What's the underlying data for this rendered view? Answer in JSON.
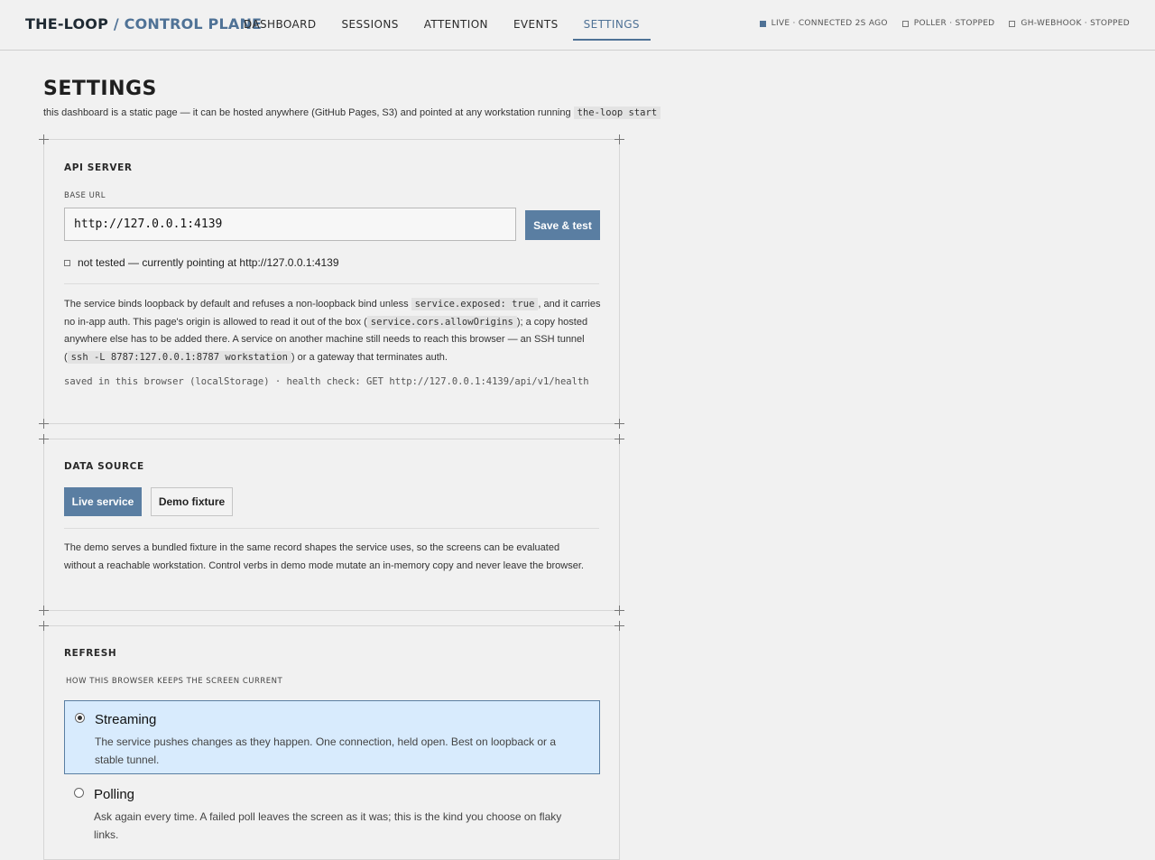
{
  "header": {
    "brand": "THE-LOOP",
    "brand_sub": "/ CONTROL PLANE",
    "nav": [
      "DASHBOARD",
      "SESSIONS",
      "ATTENTION",
      "EVENTS",
      "SETTINGS"
    ],
    "active_nav": "SETTINGS",
    "status": [
      {
        "label": "LIVE · CONNECTED 2S AGO",
        "state": "on"
      },
      {
        "label": "POLLER · STOPPED",
        "state": "off"
      },
      {
        "label": "GH-WEBHOOK · STOPPED",
        "state": "off"
      }
    ]
  },
  "page": {
    "title": "SETTINGS",
    "subtitle": "this dashboard is a static page — it can be hosted anywhere (GitHub Pages, S3) and pointed at any workstation running",
    "subtitle_code": "the-loop start"
  },
  "api_server": {
    "title": "API SERVER",
    "base_url_label": "BASE URL",
    "base_url_value": "http://127.0.0.1:4139",
    "save_button": "Save & test",
    "test_status": "not tested — currently pointing at http://127.0.0.1:4139",
    "para_1": "The service binds loopback by default and refuses a non-loopback bind unless",
    "code_1": "service.exposed: true",
    "para_2": ", and it carries no in-app auth. This page's origin is allowed to read it out of the box (",
    "code_2": "service.cors.allowOrigins",
    "para_3": "); a copy hosted anywhere else has to be added there. A service on another machine still needs to reach this browser — an SSH tunnel (",
    "code_3": "ssh -L 8787:127.0.0.1:8787 workstation",
    "para_4": ") or a gateway that terminates auth.",
    "storage_note": "saved in this browser (localStorage) · health check: GET http://127.0.0.1:4139/api/v1/health"
  },
  "data_source": {
    "title": "DATA SOURCE",
    "live_button": "Live service",
    "demo_button": "Demo fixture",
    "description": "The demo serves a bundled fixture in the same record shapes the service uses, so the screens can be evaluated without a reachable workstation. Control verbs in demo mode mutate an in-memory copy and never leave the browser."
  },
  "refresh": {
    "title": "REFRESH",
    "subtitle": "HOW THIS BROWSER KEEPS THE SCREEN CURRENT",
    "options": [
      {
        "title": "Streaming",
        "description": "The service pushes changes as they happen. One connection, held open. Best on loopback or a stable tunnel.",
        "selected": true
      },
      {
        "title": "Polling",
        "description": "Ask again every time. A failed poll leaves the screen as it was; this is the kind you choose on flaky links.",
        "selected": false
      }
    ]
  },
  "colors": {
    "accent": "#4f7296",
    "button": "#5a7ea2",
    "selected_bg": "#d8ebfd"
  }
}
